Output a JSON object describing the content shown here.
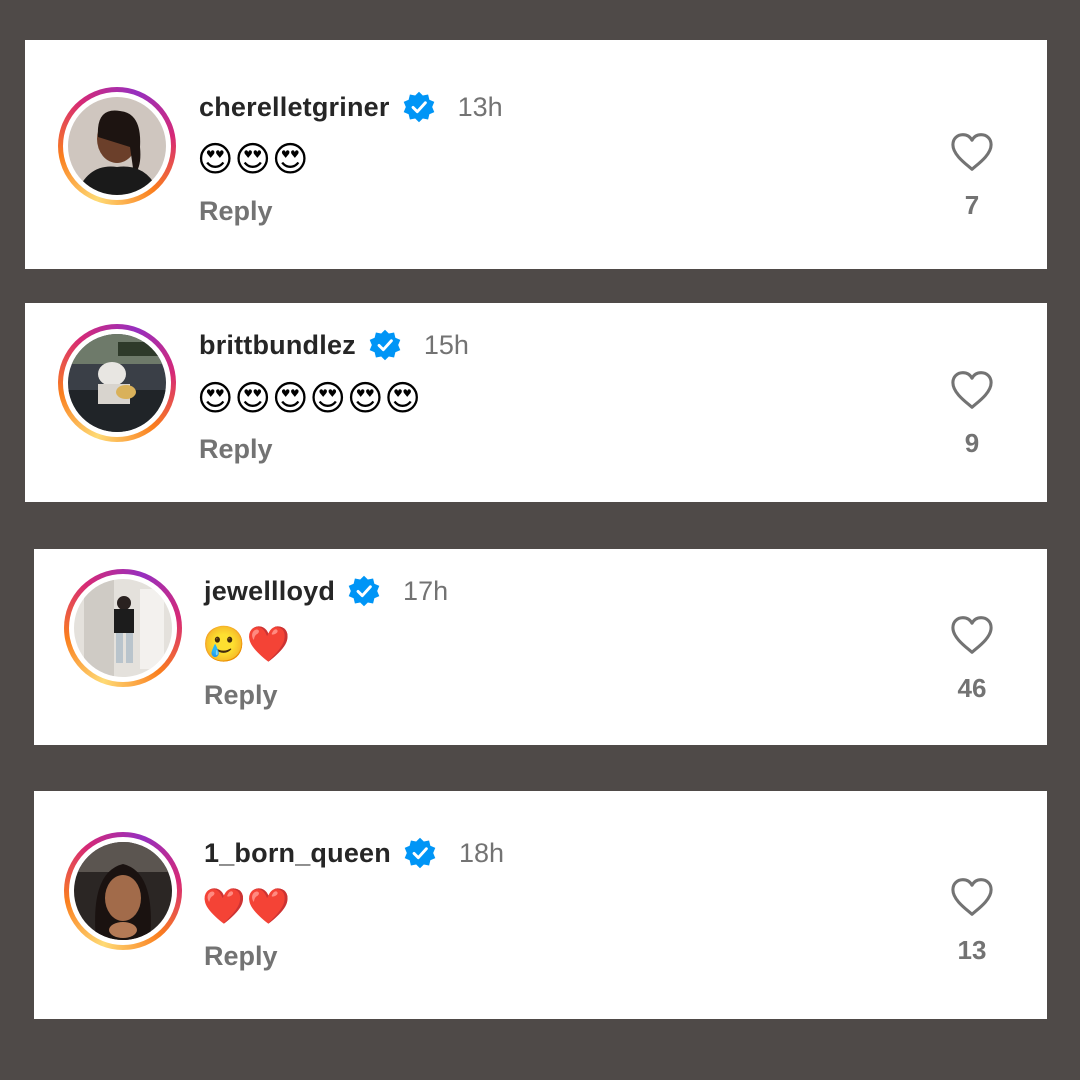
{
  "comments": [
    {
      "username": "cherelletgriner",
      "time": "13h",
      "text": "😍😍😍",
      "reply_label": "Reply",
      "likes": "7",
      "avatar": "avatar-photo"
    },
    {
      "username": "brittbundlez",
      "time": "15h",
      "text": "😍😍😍😍😍😍",
      "reply_label": "Reply",
      "likes": "9",
      "avatar": "avatar-photo"
    },
    {
      "username": "jewellloyd",
      "time": "17h",
      "text": "🥲❤️",
      "reply_label": "Reply",
      "likes": "46",
      "avatar": "avatar-photo"
    },
    {
      "username": "1_born_queen",
      "time": "18h",
      "text": "❤️❤️",
      "reply_label": "Reply",
      "likes": "13",
      "avatar": "avatar-photo"
    }
  ],
  "colors": {
    "background": "#4f4a48",
    "card": "#ffffff",
    "verified": "#0095f6",
    "text": "#262626",
    "muted": "#737373"
  },
  "icons": {
    "verified": "verified-badge-icon",
    "like": "heart-outline-icon"
  }
}
